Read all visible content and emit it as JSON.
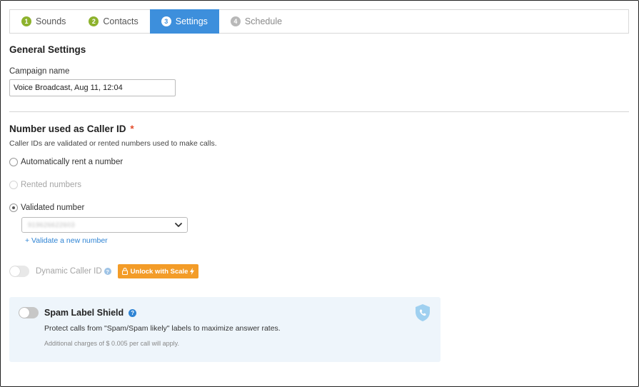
{
  "tabs": [
    {
      "num": "1",
      "label": "Sounds",
      "state": "done"
    },
    {
      "num": "2",
      "label": "Contacts",
      "state": "done"
    },
    {
      "num": "3",
      "label": "Settings",
      "state": "active"
    },
    {
      "num": "4",
      "label": "Schedule",
      "state": "todo"
    }
  ],
  "general": {
    "heading": "General Settings",
    "campaign_label": "Campaign name",
    "campaign_value": "Voice Broadcast, Aug 11, 12:04"
  },
  "caller_id": {
    "heading": "Number used as Caller ID",
    "required_mark": "*",
    "description": "Caller IDs are validated or rented numbers used to make calls.",
    "options": [
      {
        "label": "Automatically rent a number",
        "checked": false,
        "disabled": false
      },
      {
        "label": "Rented numbers",
        "checked": false,
        "disabled": true
      },
      {
        "label": "Validated number",
        "checked": true,
        "disabled": false
      }
    ],
    "selected_number": "919626622603",
    "validate_link": "+ Validate a new number"
  },
  "dynamic_caller": {
    "label": "Dynamic Caller ID",
    "help": "?",
    "enabled": false,
    "unlock_label": "Unlock with Scale"
  },
  "spam_shield": {
    "title": "Spam Label Shield",
    "help": "?",
    "enabled": false,
    "description": "Protect calls from \"Spam/Spam likely\" labels to maximize answer rates.",
    "note": "Additional charges of $ 0.005 per call will apply."
  },
  "colors": {
    "accent": "#3d8fdc",
    "done": "#8db22d",
    "required": "#e34c2a",
    "unlock": "#f39c28",
    "link": "#2f84d4"
  }
}
